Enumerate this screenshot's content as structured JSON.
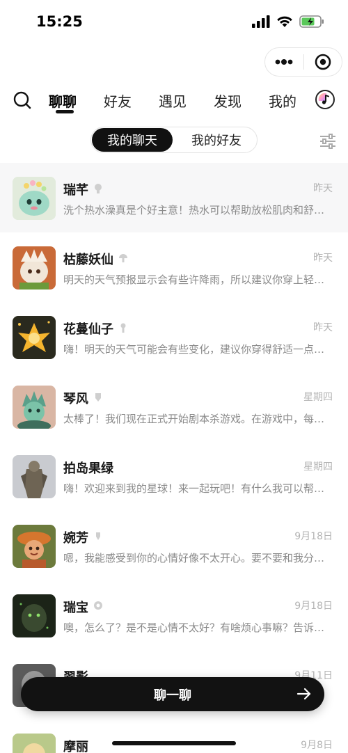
{
  "status_bar": {
    "time": "15:25",
    "battery_color": "#5ac85a"
  },
  "capsule": {
    "more_icon": "more-dots-icon",
    "close_icon": "target-circle-icon"
  },
  "nav": {
    "tabs": [
      {
        "label": "聊聊",
        "active": true
      },
      {
        "label": "好友",
        "active": false
      },
      {
        "label": "遇见",
        "active": false
      },
      {
        "label": "发现",
        "active": false
      },
      {
        "label": "我的",
        "active": false
      }
    ]
  },
  "segment": {
    "active_label": "我的聊天",
    "inactive_label": "我的好友"
  },
  "chats": [
    {
      "name": "瑞芊",
      "time": "昨天",
      "preview": "洗个热水澡真是个好主意！热水可以帮助放松肌肉和舒缓压力。"
    },
    {
      "name": "枯藤妖仙",
      "time": "昨天",
      "preview": "明天的天气预报显示会有些许降雨，所以建议你穿上轻便的雨衣。"
    },
    {
      "name": "花蔓仙子",
      "time": "昨天",
      "preview": "嗨！明天的天气可能会有些变化，建议你穿得舒适一点哦。"
    },
    {
      "name": "琴风",
      "time": "星期四",
      "preview": "太棒了！我们现在正式开始剧本杀游戏。在游戏中，每个人都有角色。"
    },
    {
      "name": "拍岛果绿",
      "time": "星期四",
      "preview": "嗨！欢迎来到我的星球！来一起玩吧！有什么我可以帮你的吗？"
    },
    {
      "name": "婉芳",
      "time": "9月18日",
      "preview": "嗯，我能感受到你的心情好像不太开心。要不要和我分享一下呢？"
    },
    {
      "name": "瑞宝",
      "time": "9月18日",
      "preview": "噢，怎么了？是不是心情不太好？有啥烦心事嘛？告诉我吧。"
    },
    {
      "name": "翠影",
      "time": "9月11日",
      "preview": ""
    },
    {
      "name": "摩丽",
      "time": "9月8日",
      "preview": ""
    }
  ],
  "bottom_button": {
    "label": "聊一聊",
    "arrow_icon": "arrow-right-icon"
  }
}
